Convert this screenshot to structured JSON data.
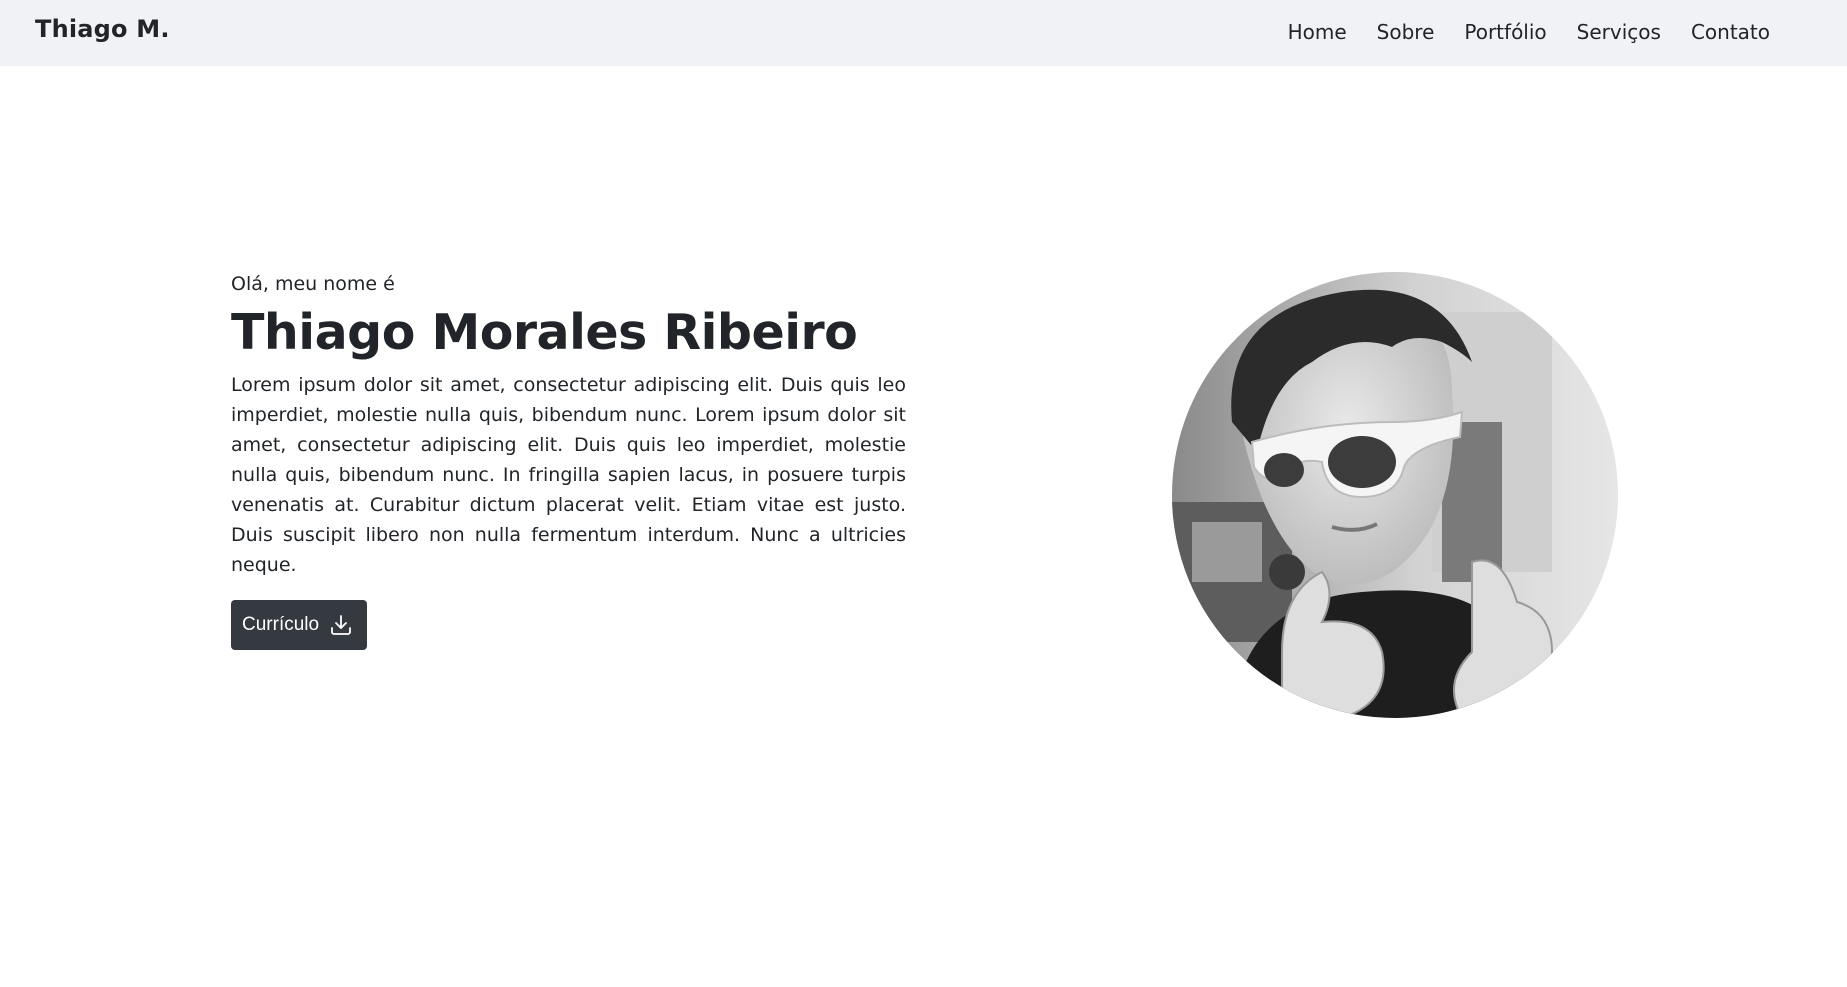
{
  "navbar": {
    "brand": "Thiago M.",
    "links": [
      {
        "label": "Home"
      },
      {
        "label": "Sobre"
      },
      {
        "label": "Portfólio"
      },
      {
        "label": "Serviços"
      },
      {
        "label": "Contato"
      }
    ],
    "background": "#f1f2f6"
  },
  "hero": {
    "greeting": "Olá, meu nome é",
    "name": "Thiago Morales Ribeiro",
    "bio": "Lorem ipsum dolor sit amet, consectetur adipiscing elit. Duis quis leo imperdiet, molestie nulla quis, bibendum nunc. Lorem ipsum dolor sit amet, consectetur adipiscing elit. Duis quis leo imperdiet, molestie nulla quis, bibendum nunc. In fringilla sapien lacus, in posuere turpis venenatis at. Curabitur dictum placerat velit. Etiam vitae est justo. Duis suscipit libero non nulla fermentum interdum. Nunc a ultricies neque.",
    "cv_button": {
      "label": "Currículo",
      "icon": "download-icon",
      "color": "#343a40"
    },
    "photo": {
      "icon": "profile-photo"
    }
  }
}
